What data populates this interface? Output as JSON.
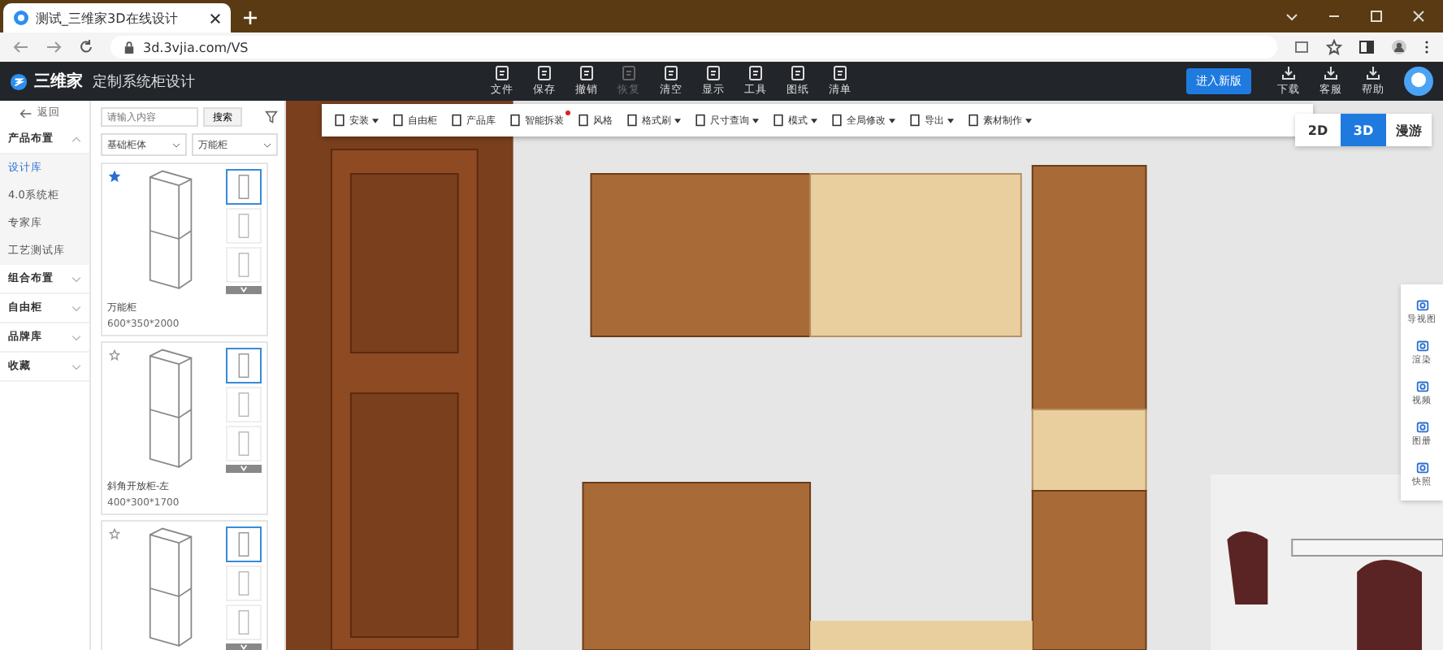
{
  "browser": {
    "tab_title": "测试_三维家3D在线设计",
    "url": "3d.3vjia.com/VS"
  },
  "header": {
    "logo_text": "三维家",
    "subtitle": "定制系统柜设计",
    "tools": [
      {
        "label": "文件",
        "disabled": false
      },
      {
        "label": "保存",
        "disabled": false
      },
      {
        "label": "撤销",
        "disabled": false
      },
      {
        "label": "恢复",
        "disabled": true
      },
      {
        "label": "清空",
        "disabled": false
      },
      {
        "label": "显示",
        "disabled": false
      },
      {
        "label": "工具",
        "disabled": false
      },
      {
        "label": "图纸",
        "disabled": false
      },
      {
        "label": "清单",
        "disabled": false
      }
    ],
    "new_version_button": "进入新版",
    "actions": [
      "下载",
      "客服",
      "帮助"
    ]
  },
  "sidebar": {
    "back": "返回",
    "groups": [
      {
        "label": "产品布置",
        "expanded": true,
        "children": [
          {
            "label": "设计库",
            "selected": true
          },
          {
            "label": "4.0系统柜",
            "selected": false
          },
          {
            "label": "专家库",
            "selected": false
          },
          {
            "label": "工艺测试库",
            "selected": false
          }
        ]
      },
      {
        "label": "组合布置",
        "expanded": false
      },
      {
        "label": "自由柜",
        "expanded": false
      },
      {
        "label": "品牌库",
        "expanded": false
      },
      {
        "label": "收藏",
        "expanded": false
      }
    ]
  },
  "catalog": {
    "search": {
      "placeholder": "请输入内容"
    },
    "search_button": "搜索",
    "filters": [
      "基础柜体",
      "万能柜"
    ],
    "products": [
      {
        "name": "万能柜",
        "size": "600*350*2000",
        "starred": true
      },
      {
        "name": "斜角开放柜-左",
        "size": "400*300*1700",
        "starred": false
      },
      {
        "starred": false
      }
    ]
  },
  "canvas_toolbar": [
    {
      "label": "安装",
      "dropdown": true,
      "badge": false
    },
    {
      "label": "自由柜",
      "dropdown": false,
      "badge": false
    },
    {
      "label": "产品库",
      "dropdown": false,
      "badge": false
    },
    {
      "label": "智能拆装",
      "dropdown": false,
      "badge": true
    },
    {
      "label": "风格",
      "dropdown": false,
      "badge": false
    },
    {
      "label": "格式刷",
      "dropdown": true,
      "badge": false
    },
    {
      "label": "尺寸查询",
      "dropdown": true,
      "badge": false
    },
    {
      "label": "模式",
      "dropdown": true,
      "badge": false
    },
    {
      "label": "全局修改",
      "dropdown": true,
      "badge": false
    },
    {
      "label": "导出",
      "dropdown": true,
      "badge": false
    },
    {
      "label": "素材制作",
      "dropdown": true,
      "badge": false
    }
  ],
  "view_modes": [
    {
      "label": "2D",
      "selected": false
    },
    {
      "label": "3D",
      "selected": true
    },
    {
      "label": "漫游",
      "selected": false
    }
  ],
  "side_tools": [
    "导视图",
    "渲染",
    "视频",
    "图册",
    "快照"
  ]
}
